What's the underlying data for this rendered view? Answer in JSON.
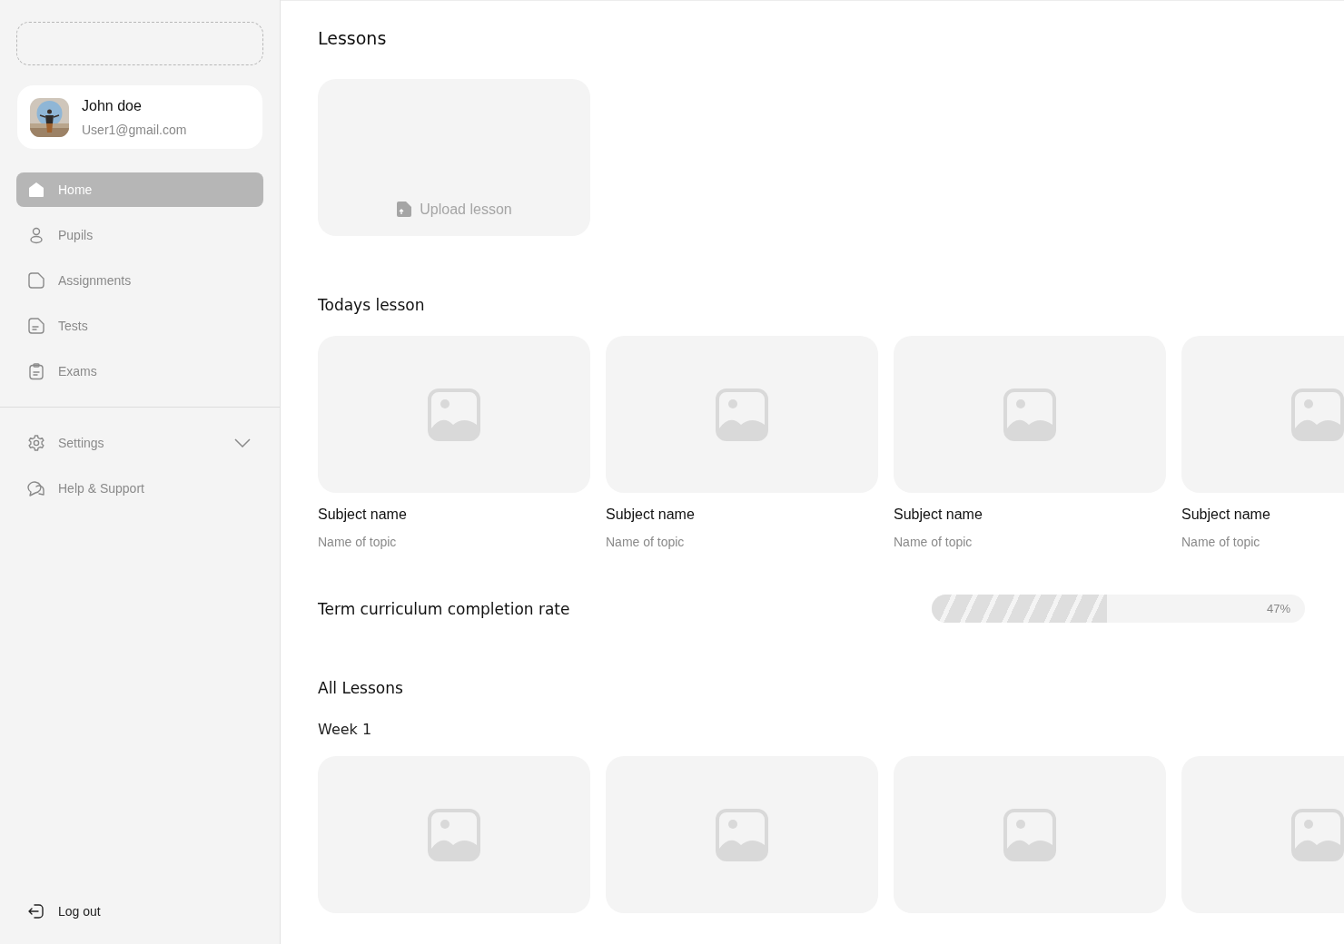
{
  "sidebar": {
    "user": {
      "name": "John doe",
      "email": "User1@gmail.com"
    },
    "nav": [
      {
        "label": "Home",
        "selected": true
      },
      {
        "label": "Pupils",
        "selected": false
      },
      {
        "label": "Assignments",
        "selected": false
      },
      {
        "label": "Tests",
        "selected": false
      },
      {
        "label": "Exams",
        "selected": false
      }
    ],
    "secondary": [
      {
        "label": "Settings",
        "expanded": false
      },
      {
        "label": "Help & Support"
      }
    ],
    "logout": "Log out"
  },
  "main": {
    "title": "Lessons",
    "upload": "Upload lesson",
    "todays": {
      "title": "Todays lesson",
      "cards": [
        {
          "subject": "Subject name",
          "topic": "Name of topic"
        },
        {
          "subject": "Subject name",
          "topic": "Name of topic"
        },
        {
          "subject": "Subject name",
          "topic": "Name of topic"
        },
        {
          "subject": "Subject name",
          "topic": "Name of topic"
        }
      ]
    },
    "completion": {
      "label": "Term curriculum completion rate",
      "level": 0.47,
      "reading": "47%"
    },
    "all": {
      "title": "All Lessons",
      "weeks": [
        {
          "label": "Week 1",
          "cards": [
            {
              "kind": "placeholder"
            },
            {
              "kind": "placeholder"
            },
            {
              "kind": "placeholder"
            },
            {
              "kind": "placeholder"
            }
          ]
        }
      ]
    }
  }
}
